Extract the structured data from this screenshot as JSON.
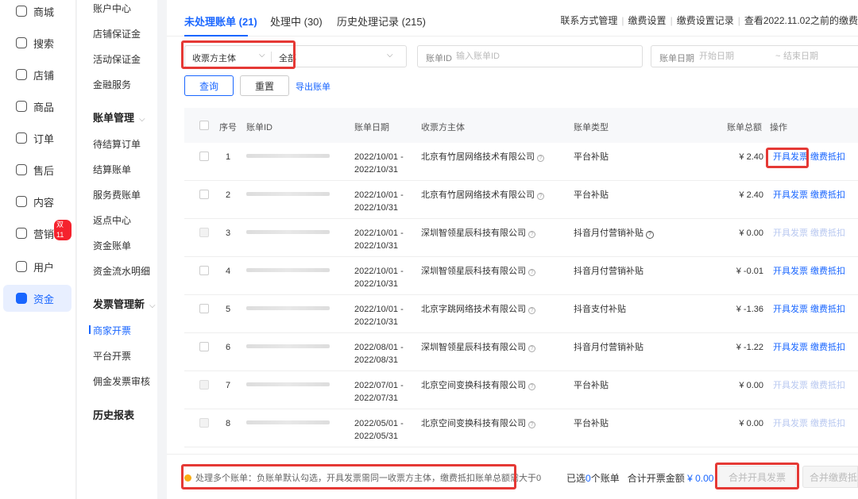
{
  "nav_primary": [
    {
      "label": "商城",
      "icon": "store-icon"
    },
    {
      "label": "搜索",
      "icon": "search-icon"
    },
    {
      "label": "店铺",
      "icon": "shop-icon"
    },
    {
      "label": "商品",
      "icon": "product-icon"
    },
    {
      "label": "订单",
      "icon": "order-icon"
    },
    {
      "label": "售后",
      "icon": "after-sales-icon"
    },
    {
      "label": "内容",
      "icon": "content-icon"
    },
    {
      "label": "营销",
      "icon": "marketing-icon",
      "badge": "双11"
    },
    {
      "label": "用户",
      "icon": "user-icon"
    },
    {
      "label": "资金",
      "icon": "funds-icon",
      "active": true
    }
  ],
  "nav_secondary": {
    "top_items": [
      "账户中心",
      "店铺保证金",
      "活动保证金",
      "金融服务"
    ],
    "group_bills": "账单管理",
    "bill_items": [
      "待结算订单",
      "结算账单",
      "服务费账单",
      "返点中心",
      "资金账单",
      "资金流水明细"
    ],
    "group_invoice": "发票管理新",
    "invoice_items": [
      "商家开票",
      "平台开票",
      "佣金发票审核"
    ],
    "group_history": "历史报表"
  },
  "tabs": [
    "未处理账单 (21)",
    "处理中 (30)",
    "历史处理记录 (215)"
  ],
  "top_links": [
    "联系方式管理",
    "缴费设置",
    "缴费设置记录",
    "查看2022.11.02之前的缴费"
  ],
  "filters": {
    "payee_label": "收票方主体",
    "payee_value": "全部",
    "bill_id_label": "账单ID",
    "bill_id_placeholder": "输入账单ID",
    "date_label": "账单日期",
    "date_start_placeholder": "开始日期",
    "date_sep": "~",
    "date_end_placeholder": "结束日期"
  },
  "actions": {
    "query": "查询",
    "reset": "重置",
    "export": "导出账单"
  },
  "columns": [
    "序号",
    "账单ID",
    "账单日期",
    "收票方主体",
    "账单类型",
    "账单总额",
    "操作"
  ],
  "rows": [
    {
      "idx": "1",
      "date": "2022/10/01 - 2022/10/31",
      "payee": "北京有竹居网络技术有限公司",
      "type": "平台补贴",
      "amount": "¥ 2.40",
      "op1": "开具发票",
      "op2": "缴费抵扣",
      "disabled": false
    },
    {
      "idx": "2",
      "date": "2022/10/01 - 2022/10/31",
      "payee": "北京有竹居网络技术有限公司",
      "type": "平台补贴",
      "amount": "¥ 2.40",
      "op1": "开具发票",
      "op2": "缴费抵扣",
      "disabled": false
    },
    {
      "idx": "3",
      "date": "2022/10/01 - 2022/10/31",
      "payee": "深圳智领星辰科技有限公司",
      "type": "抖音月付营销补贴",
      "amount": "¥ 0.00",
      "op1": "开具发票",
      "op2": "缴费抵扣",
      "disabled": true
    },
    {
      "idx": "4",
      "date": "2022/10/01 - 2022/10/31",
      "payee": "深圳智领星辰科技有限公司",
      "type": "抖音月付营销补贴",
      "amount": "¥ -0.01",
      "op1": "开具发票",
      "op2": "缴费抵扣",
      "disabled": false
    },
    {
      "idx": "5",
      "date": "2022/10/01 - 2022/10/31",
      "payee": "北京字跳网络技术有限公司",
      "type": "抖音支付补贴",
      "amount": "¥ -1.36",
      "op1": "开具发票",
      "op2": "缴费抵扣",
      "disabled": false
    },
    {
      "idx": "6",
      "date": "2022/08/01 - 2022/08/31",
      "payee": "深圳智领星辰科技有限公司",
      "type": "抖音月付营销补贴",
      "amount": "¥ -1.22",
      "op1": "开具发票",
      "op2": "缴费抵扣",
      "disabled": false
    },
    {
      "idx": "7",
      "date": "2022/07/01 - 2022/07/31",
      "payee": "北京空间变换科技有限公司",
      "type": "平台补贴",
      "amount": "¥ 0.00",
      "op1": "开具发票",
      "op2": "缴费抵扣",
      "disabled": true
    },
    {
      "idx": "8",
      "date": "2022/05/01 - 2022/05/31",
      "payee": "北京空间变换科技有限公司",
      "type": "平台补贴",
      "amount": "¥ 0.00",
      "op1": "开具发票",
      "op2": "缴费抵扣",
      "disabled": true
    }
  ],
  "footer": {
    "notice": "处理多个账单：负账单默认勾选，开具发票需同一收票方主体，缴费抵扣账单总额需大于0",
    "selected_prefix": "已选",
    "selected_count": "0",
    "selected_suffix": "个账单",
    "total_label": "合计开票金额",
    "total_value": "¥ 0.00",
    "merge_invoice": "合并开具发票",
    "merge_deduct": "合并缴费抵扣"
  },
  "colors": {
    "accent": "#1966ff",
    "highlight": "#e53935",
    "warning": "#faad14"
  }
}
